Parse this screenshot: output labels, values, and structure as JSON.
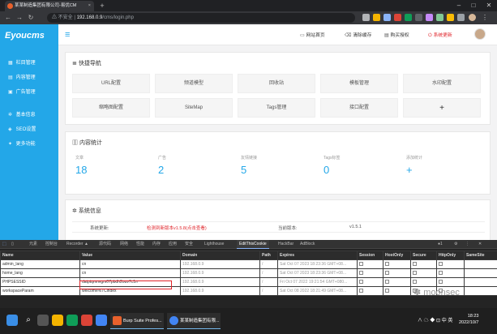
{
  "browser": {
    "tab_title": "某某制造集团有限公司-易优CM",
    "close_glyph": "×",
    "newtab_glyph": "+",
    "url_insecure": "不安全",
    "url_host": "192.168.0.9",
    "url_path": "/cms/login.php"
  },
  "sidebar": {
    "logo": "Eyoucms",
    "groups": [
      {
        "icon": "grid-icon",
        "glyph": "▦",
        "label": "栏目管理"
      },
      {
        "icon": "doc-icon",
        "glyph": "▤",
        "label": "内容管理"
      },
      {
        "icon": "ad-icon",
        "glyph": "▣",
        "label": "广告管理"
      },
      {
        "icon": "gear-icon",
        "glyph": "✲",
        "label": "基本信息"
      },
      {
        "icon": "seo-icon",
        "glyph": "◈",
        "label": "SEO设置"
      },
      {
        "icon": "more-icon",
        "glyph": "✦",
        "label": "更多功能"
      }
    ]
  },
  "topbar": {
    "menu_glyph": "≡",
    "links": [
      {
        "icon": "monitor-icon",
        "glyph": "▭",
        "label": "网站首页"
      },
      {
        "icon": "trash-icon",
        "glyph": "⌫",
        "label": "清除缓存"
      },
      {
        "icon": "cart-icon",
        "glyph": "▤",
        "label": "购买授权"
      },
      {
        "icon": "power-icon",
        "glyph": "⏻",
        "label": "系统更新"
      }
    ]
  },
  "quick_nav": {
    "title": "快捷导航",
    "title_glyph": "≣",
    "buttons": [
      "URL配置",
      "频道模型",
      "回收站",
      "模板管理",
      "水印配置",
      "缩略图配置",
      "SiteMap",
      "Tags管理",
      "接口配置",
      "+"
    ]
  },
  "stats": {
    "title": "内容统计",
    "title_glyph": "▥",
    "items": [
      {
        "label": "文章",
        "value": "18"
      },
      {
        "label": "广告",
        "value": "2"
      },
      {
        "label": "友情链接",
        "value": "5"
      },
      {
        "label": "Tags标签",
        "value": "0"
      },
      {
        "label": "添加统计",
        "value": "+"
      }
    ]
  },
  "system": {
    "title": "系统信息",
    "title_glyph": "✲",
    "row_label": "系统更新:",
    "row_value": "检测到新版本v1.5.8(点击查看)",
    "version_label": "当前版本:",
    "version_value": "v1.5.1"
  },
  "devtools": {
    "tabs": [
      "元素",
      "控制台",
      "Recorder ▲",
      "源代码",
      "网络",
      "性能",
      "内存",
      "应用",
      "安全",
      "Lighthouse",
      "EditThisCookie",
      "HackBar",
      "AdBlock"
    ],
    "active_tab": "EditThisCookie",
    "columns": [
      "Name",
      "Value",
      "Domain",
      "Path",
      "Expires",
      "Session",
      "HostOnly",
      "Secure",
      "HttpOnly",
      "SameSite"
    ],
    "rows": [
      {
        "name": "admin_lang",
        "value": "cn",
        "domain": "192.168.0.9",
        "path": "/",
        "expires": "Sat Oct 07 2023 18:23:36 GMT+08..."
      },
      {
        "name": "home_lang",
        "value": "cn",
        "domain": "192.168.0.9",
        "path": "/",
        "expires": "Sat Oct 07 2023 18:23:36 GMT+08..."
      },
      {
        "name": "PHPSESSID",
        "value": "datptqnmvgm07pbdh2ouv7c1n",
        "domain": "192.168.0.9",
        "path": "/",
        "expires": "Fri Oct 07 2022 19:21:54 GMT+080..."
      },
      {
        "name": "workspaceParam",
        "value": "welcome%7Cindex",
        "domain": "192.168.0.9",
        "path": "/",
        "expires": "Sat Oct 08 2022 18:21:49 GMT+08..."
      }
    ]
  },
  "taskbar": {
    "apps": [
      {
        "label": "Burp Suite Profes...",
        "color": "#e8612c"
      },
      {
        "label": "某某制造集团有限...",
        "color": "#4285f4"
      }
    ],
    "tray": "∧  ☁  ◆  ⊡  中  英",
    "time": "18:23",
    "date": "2022/10/7"
  },
  "watermark": "moonsec",
  "colors": {
    "sidebar": "#23a7e8",
    "accent": "#23a7e8",
    "alert": "#e0242a"
  }
}
